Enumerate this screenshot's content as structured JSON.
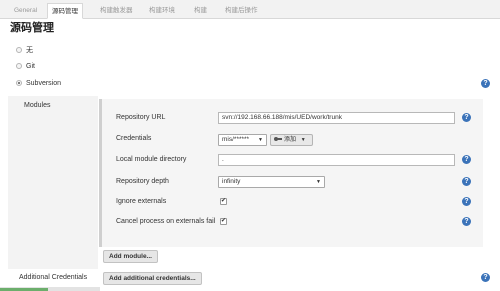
{
  "tabs": [
    {
      "label": "General"
    },
    {
      "label": "源码管理"
    },
    {
      "label": "构建触发器"
    },
    {
      "label": "构建环境"
    },
    {
      "label": "构建"
    },
    {
      "label": "构建后操作"
    }
  ],
  "section_title": "源码管理",
  "scm_options": [
    {
      "label": "无",
      "selected": false
    },
    {
      "label": "Git",
      "selected": false
    },
    {
      "label": "Subversion",
      "selected": true
    }
  ],
  "help_glyph": "?",
  "modules": {
    "label": "Modules",
    "repository_url": {
      "label": "Repository URL",
      "value": "svn://192.168.66.188/mis/UED/work/trunk"
    },
    "credentials": {
      "label": "Credentials",
      "selected": "mis/******",
      "add_button": "添加"
    },
    "local_module_directory": {
      "label": "Local module directory",
      "value": "."
    },
    "repository_depth": {
      "label": "Repository depth",
      "selected": "infinity"
    },
    "ignore_externals": {
      "label": "Ignore externals",
      "checked": true
    },
    "cancel_on_externals_fail": {
      "label": "Cancel process on externals fail",
      "checked": true
    },
    "add_module_button": "Add module..."
  },
  "additional_credentials": {
    "label": "Additional Credentials",
    "button": "Add additional credentials..."
  },
  "colors": {
    "help_icon": "#3b73b9",
    "tab_bar": "#f2f2f2",
    "panel": "#f5f5f5"
  }
}
